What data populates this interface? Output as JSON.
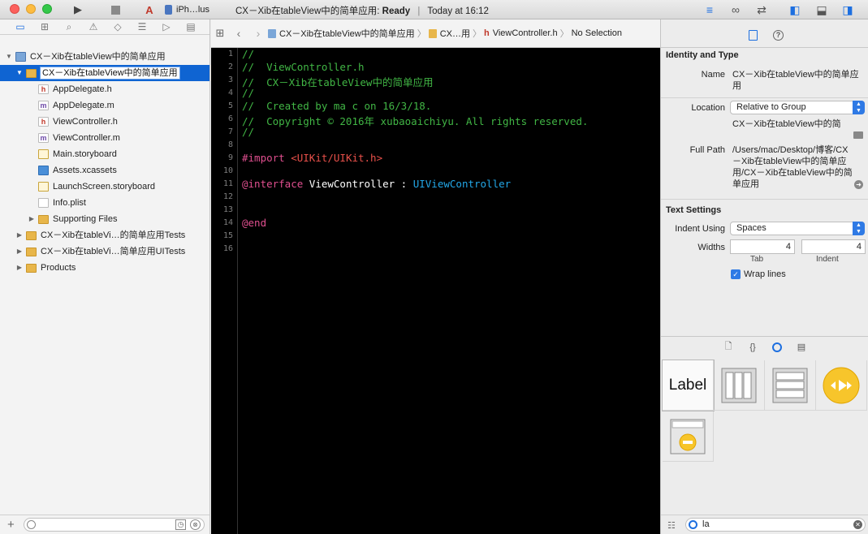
{
  "toolbar": {
    "device": "iPh…lus",
    "status_project": "CX－Xib在tableView中的简单应用:",
    "status_state": "Ready",
    "status_time": "Today at 16:12"
  },
  "navigator": {
    "tree": [
      {
        "label": "CX－Xib在tableView中的简单应用",
        "icon": "project-icon",
        "kind": "proj",
        "depth": 0,
        "disclosure": "open",
        "selected": false
      },
      {
        "label": "CX－Xib在tableView中的简单应用",
        "icon": "folder-icon",
        "kind": "folder",
        "depth": 1,
        "disclosure": "open",
        "selected": true
      },
      {
        "label": "AppDelegate.h",
        "icon": "header-file-icon",
        "kind": "file-h",
        "depth": 2,
        "disclosure": "",
        "selected": false
      },
      {
        "label": "AppDelegate.m",
        "icon": "objc-file-icon",
        "kind": "file-m",
        "depth": 2,
        "disclosure": "",
        "selected": false
      },
      {
        "label": "ViewController.h",
        "icon": "header-file-icon",
        "kind": "file-h",
        "depth": 2,
        "disclosure": "",
        "selected": false
      },
      {
        "label": "ViewController.m",
        "icon": "objc-file-icon",
        "kind": "file-m",
        "depth": 2,
        "disclosure": "",
        "selected": false
      },
      {
        "label": "Main.storyboard",
        "icon": "storyboard-icon",
        "kind": "sb",
        "depth": 2,
        "disclosure": "",
        "selected": false
      },
      {
        "label": "Assets.xcassets",
        "icon": "assets-icon",
        "kind": "assets",
        "depth": 2,
        "disclosure": "",
        "selected": false
      },
      {
        "label": "LaunchScreen.storyboard",
        "icon": "storyboard-icon",
        "kind": "sb",
        "depth": 2,
        "disclosure": "",
        "selected": false
      },
      {
        "label": "Info.plist",
        "icon": "plist-icon",
        "kind": "plist",
        "depth": 2,
        "disclosure": "",
        "selected": false
      },
      {
        "label": "Supporting Files",
        "icon": "folder-icon",
        "kind": "folder",
        "depth": 2,
        "disclosure": "closed",
        "selected": false
      },
      {
        "label": "CX－Xib在tableVi…的简单应用Tests",
        "icon": "folder-icon",
        "kind": "folder",
        "depth": 1,
        "disclosure": "closed",
        "selected": false
      },
      {
        "label": "CX－Xib在tableVi…简单应用UITests",
        "icon": "folder-icon",
        "kind": "folder",
        "depth": 1,
        "disclosure": "closed",
        "selected": false
      },
      {
        "label": "Products",
        "icon": "folder-icon",
        "kind": "folder",
        "depth": 1,
        "disclosure": "closed",
        "selected": false
      }
    ]
  },
  "jumpbar": {
    "crumb_project": "CX－Xib在tableView中的简单应用",
    "crumb_group": "CX…用",
    "crumb_file": "ViewController.h",
    "crumb_selection": "No Selection"
  },
  "editor": {
    "lines": [
      [
        {
          "t": "//",
          "c": "green"
        }
      ],
      [
        {
          "t": "//  ViewController.h",
          "c": "green"
        }
      ],
      [
        {
          "t": "//  CX－Xib在tableView中的简单应用",
          "c": "green"
        }
      ],
      [
        {
          "t": "//",
          "c": "green"
        }
      ],
      [
        {
          "t": "//  Created by ma c on 16/3/18.",
          "c": "green"
        }
      ],
      [
        {
          "t": "//  Copyright © 2016年 xubaoaichiyu. All rights reserved.",
          "c": "green"
        }
      ],
      [
        {
          "t": "//",
          "c": "green"
        }
      ],
      [],
      [
        {
          "t": "#import ",
          "c": "pink"
        },
        {
          "t": "<UIKit/UIKit.h>",
          "c": "red"
        }
      ],
      [],
      [
        {
          "t": "@interface",
          "c": "pink"
        },
        {
          "t": " ViewController : ",
          "c": "white"
        },
        {
          "t": "UIViewController",
          "c": "blue"
        }
      ],
      [],
      [],
      [
        {
          "t": "@end",
          "c": "pink"
        }
      ],
      [],
      []
    ]
  },
  "inspector": {
    "identity_title": "Identity and Type",
    "name_label": "Name",
    "name_value": "CX－Xib在tableView中的简单应用",
    "location_label": "Location",
    "location_value": "Relative to Group",
    "location_path": "CX－Xib在tableView中的简",
    "fullpath_label": "Full Path",
    "fullpath_value": "/Users/mac/Desktop/博客/CX－Xib在tableView中的简单应用/CX－Xib在tableView中的简单应用",
    "text_settings_title": "Text Settings",
    "indent_using_label": "Indent Using",
    "indent_using_value": "Spaces",
    "widths_label": "Widths",
    "tab_width": "4",
    "indent_width": "4",
    "tab_label": "Tab",
    "indent_label": "Indent",
    "wrap_lines_label": "Wrap lines",
    "wrap_lines_checked": true,
    "library_first_tile": "Label",
    "filter_value": "la"
  },
  "colors": {
    "selection": "#0f64d2",
    "accent": "#1d6fe0",
    "comment": "#41b645",
    "keyword": "#e04f8f",
    "string": "#e8504a",
    "type": "#23a8e8"
  }
}
